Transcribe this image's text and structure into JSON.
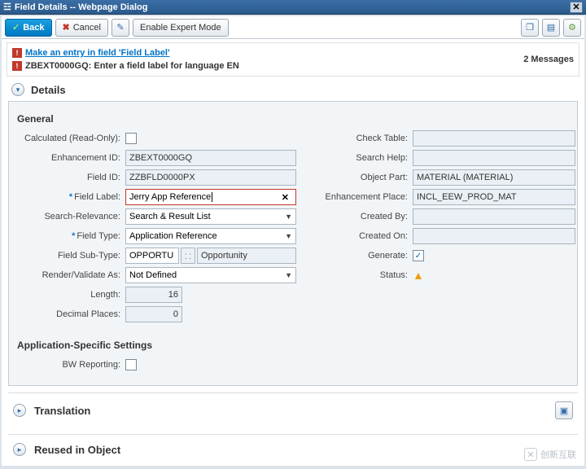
{
  "window": {
    "title": "Field Details -- Webpage Dialog"
  },
  "toolbar": {
    "back": "Back",
    "cancel": "Cancel",
    "expert": "Enable Expert Mode"
  },
  "messages": {
    "items": [
      {
        "link": "Make an entry in field 'Field Label'"
      },
      {
        "text": "ZBEXT0000GQ: Enter a field label for language EN"
      }
    ],
    "count_label": "2 Messages"
  },
  "sections": {
    "details": "Details",
    "translation": "Translation",
    "reused": "Reused in Object"
  },
  "groups": {
    "general": "General",
    "app_specific": "Application-Specific Settings"
  },
  "fields": {
    "calc_ro": {
      "label": "Calculated (Read-Only):",
      "checked": false
    },
    "enh_id": {
      "label": "Enhancement ID:",
      "value": "ZBEXT0000GQ"
    },
    "field_id": {
      "label": "Field ID:",
      "value": "ZZBFLD0000PX"
    },
    "field_label": {
      "label": "Field Label:",
      "value": "Jerry App Reference",
      "required": true
    },
    "search_rel": {
      "label": "Search-Relevance:",
      "value": "Search & Result List"
    },
    "field_type": {
      "label": "Field Type:",
      "value": "Application Reference",
      "required": true
    },
    "field_subtype": {
      "label": "Field Sub-Type:",
      "short": "OPPORTU",
      "long": "Opportunity"
    },
    "render_as": {
      "label": "Render/Validate As:",
      "value": "Not Defined"
    },
    "length": {
      "label": "Length:",
      "value": "16"
    },
    "decimals": {
      "label": "Decimal Places:",
      "value": "0"
    },
    "check_table": {
      "label": "Check Table:",
      "value": ""
    },
    "search_help": {
      "label": "Search Help:",
      "value": ""
    },
    "object_part": {
      "label": "Object Part:",
      "value": "MATERIAL (MATERIAL)"
    },
    "enh_place": {
      "label": "Enhancement Place:",
      "value": "INCL_EEW_PROD_MAT"
    },
    "created_by": {
      "label": "Created By:",
      "value": ""
    },
    "created_on": {
      "label": "Created On:",
      "value": ""
    },
    "generate": {
      "label": "Generate:",
      "checked": true
    },
    "status": {
      "label": "Status:"
    },
    "bw_report": {
      "label": "BW Reporting:",
      "checked": false
    }
  },
  "watermark": "创新互联"
}
